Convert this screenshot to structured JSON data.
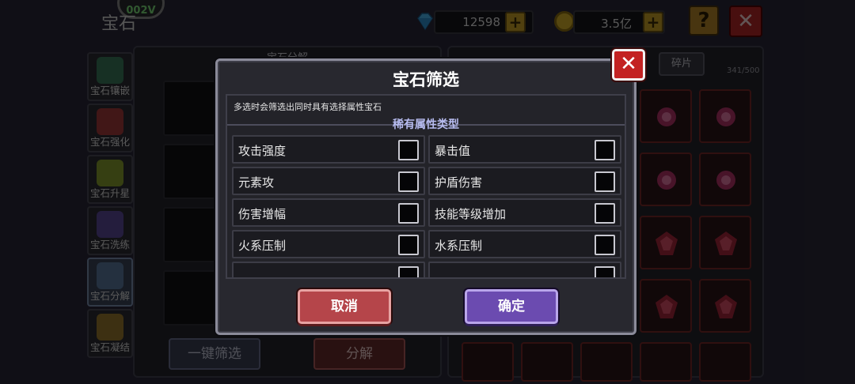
{
  "header": {
    "title": "宝石",
    "level_badge": "002V",
    "diamonds": "12598",
    "gold": "3.5亿",
    "help_label": "?",
    "close_label": "✕"
  },
  "sidebar": {
    "items": [
      {
        "label": "宝石镶嵌"
      },
      {
        "label": "宝石强化"
      },
      {
        "label": "宝石升星"
      },
      {
        "label": "宝石洗练"
      },
      {
        "label": "宝石分解"
      },
      {
        "label": "宝石凝结"
      }
    ]
  },
  "left_panel": {
    "title": "宝石分解",
    "filter_button": "一键筛选",
    "decompose_button": "分解"
  },
  "right_panel": {
    "tab_fragments": "碎片",
    "count": "341/500"
  },
  "modal": {
    "title": "宝石筛选",
    "close_label": "✕",
    "hint": "多选时会筛选出同时具有选择属性宝石",
    "section_title": "稀有属性类型",
    "options": [
      {
        "label": "攻击强度",
        "checked": false
      },
      {
        "label": "暴击值",
        "checked": false
      },
      {
        "label": "元素攻",
        "checked": false
      },
      {
        "label": "护盾伤害",
        "checked": false
      },
      {
        "label": "伤害增幅",
        "checked": false
      },
      {
        "label": "技能等级增加",
        "checked": false
      },
      {
        "label": "火系压制",
        "checked": false
      },
      {
        "label": "水系压制",
        "checked": false
      }
    ],
    "cancel_label": "取消",
    "confirm_label": "确定"
  },
  "colors": {
    "cancel": "#b5454a",
    "confirm": "#6b4bb0",
    "close": "#c32222",
    "section_title": "#b7bcf0"
  }
}
